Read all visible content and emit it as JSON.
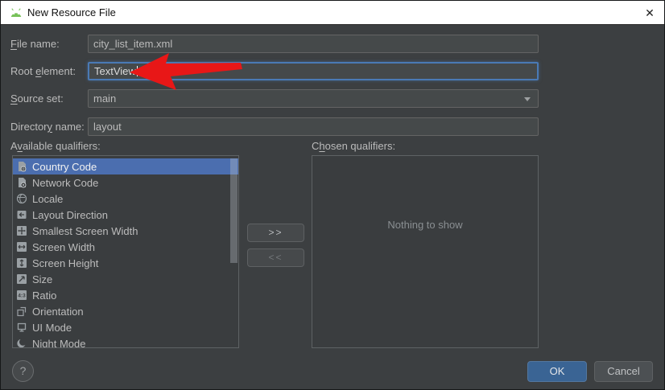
{
  "window": {
    "title": "New Resource File",
    "close_glyph": "✕"
  },
  "form": {
    "file_name": {
      "label": {
        "pre": "",
        "mnemonic": "F",
        "post": "ile name:"
      },
      "value": "city_list_item.xml"
    },
    "root_element": {
      "label": {
        "pre": "Root ",
        "mnemonic": "e",
        "post": "lement:"
      },
      "value": "TextView"
    },
    "source_set": {
      "label": {
        "pre": "",
        "mnemonic": "S",
        "post": "ource set:"
      },
      "value": "main"
    },
    "directory_name": {
      "label": {
        "pre": "Director",
        "mnemonic": "y",
        "post": " name:"
      },
      "value": "layout"
    }
  },
  "qualifiers": {
    "available": {
      "label": {
        "pre": "A",
        "mnemonic": "v",
        "post": "ailable qualifiers:"
      },
      "items": [
        {
          "label": "Country Code",
          "selected": true
        },
        {
          "label": "Network Code"
        },
        {
          "label": "Locale"
        },
        {
          "label": "Layout Direction"
        },
        {
          "label": "Smallest Screen Width"
        },
        {
          "label": "Screen Width"
        },
        {
          "label": "Screen Height"
        },
        {
          "label": "Size"
        },
        {
          "label": "Ratio"
        },
        {
          "label": "Orientation"
        },
        {
          "label": "UI Mode"
        },
        {
          "label": "Night Mode"
        }
      ],
      "ratio_icon_text": "4:3"
    },
    "chosen": {
      "label": {
        "pre": "C",
        "mnemonic": "h",
        "post": "osen qualifiers:"
      },
      "empty_text": "Nothing to show"
    },
    "move_right_label": ">>",
    "move_left_label": "<<"
  },
  "buttons": {
    "ok": "OK",
    "cancel": "Cancel",
    "help": "?"
  },
  "colors": {
    "selection": "#4b6eaf",
    "focus_border": "#4a7ab5",
    "ok_button": "#3a6494",
    "annotation_arrow": "#e81717",
    "titlebar": "#ffffff",
    "dialog_bg": "#3c3f41"
  }
}
